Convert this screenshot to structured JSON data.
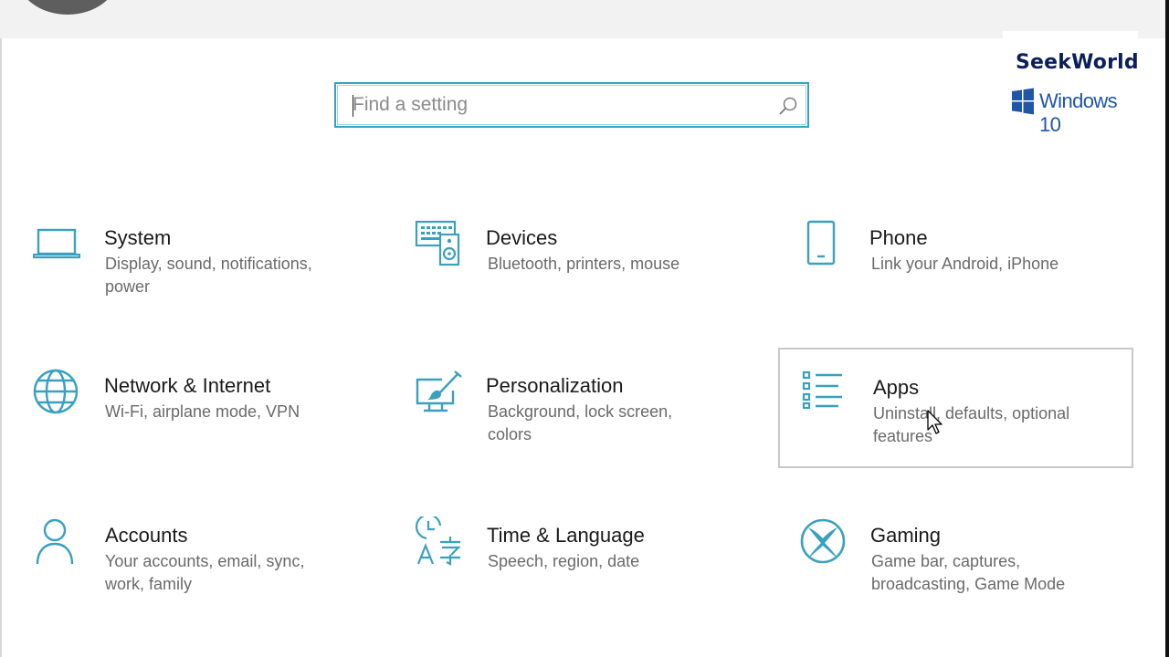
{
  "search": {
    "placeholder": "Find a setting"
  },
  "watermark": {
    "title": "SeekWorld",
    "os": "Windows 10"
  },
  "colors": {
    "accent": "#3aa0bf",
    "watermark_text": "#0b1f5c",
    "windows_blue": "#1f56a8"
  },
  "categories": [
    {
      "title": "System",
      "description": "Display, sound, notifications, power",
      "icon": "laptop-icon"
    },
    {
      "title": "Devices",
      "description": "Bluetooth, printers, mouse",
      "icon": "devices-icon"
    },
    {
      "title": "Phone",
      "description": "Link your Android, iPhone",
      "icon": "phone-icon"
    },
    {
      "title": "Network & Internet",
      "description": "Wi-Fi, airplane mode, VPN",
      "icon": "globe-icon"
    },
    {
      "title": "Personalization",
      "description": "Background, lock screen, colors",
      "icon": "paint-brush-icon"
    },
    {
      "title": "Apps",
      "description": "Uninstall, defaults, optional features",
      "icon": "apps-list-icon"
    },
    {
      "title": "Accounts",
      "description": "Your accounts, email, sync, work, family",
      "icon": "person-icon"
    },
    {
      "title": "Time & Language",
      "description": "Speech, region, date",
      "icon": "time-language-icon"
    },
    {
      "title": "Gaming",
      "description": "Game bar, captures, broadcasting, Game Mode",
      "icon": "xbox-icon"
    }
  ]
}
